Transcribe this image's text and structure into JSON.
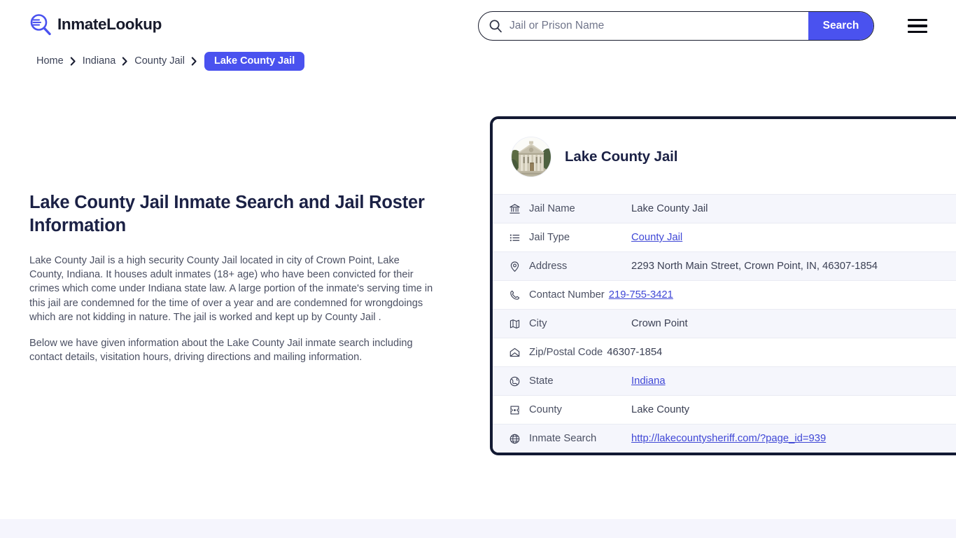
{
  "header": {
    "logo_text": "InmateLookup",
    "logo_icon": "magnifier-list-icon",
    "search": {
      "placeholder": "Jail or Prison Name",
      "value": "",
      "button_label": "Search",
      "icon": "search-icon"
    },
    "menu_icon": "hamburger-menu-icon"
  },
  "breadcrumb": {
    "items": [
      {
        "label": "Home",
        "current": false
      },
      {
        "label": "Indiana",
        "current": false
      },
      {
        "label": "County Jail",
        "current": false
      },
      {
        "label": "Lake County Jail",
        "current": true
      }
    ],
    "separator_icon": "chevron-right-icon"
  },
  "intro": {
    "title": "Lake County Jail Inmate Search and Jail Roster Information",
    "paragraph_1": "Lake County Jail is a high security County Jail located in city of Crown Point, Lake County, Indiana. It houses adult inmates (18+ age) who have been convicted for their crimes which come under Indiana state law. A large portion of the inmate's serving time in this jail are condemned for the time of over a year and are condemned for wrongdoings which are not kidding in nature. The jail is worked and kept up by County Jail .",
    "paragraph_2": "Below we have given information about the Lake County Jail inmate search including contact details, visitation hours, driving directions and mailing information."
  },
  "card": {
    "title": "Lake County Jail",
    "avatar_alt": "courthouse-building-photo",
    "rows": [
      {
        "icon": "bank-icon",
        "label": "Jail Name",
        "value": "Lake County Jail",
        "link": false
      },
      {
        "icon": "list-icon",
        "label": "Jail Type",
        "value": "County Jail",
        "link": true
      },
      {
        "icon": "map-pin-icon",
        "label": "Address",
        "value": "2293 North Main Street, Crown Point, IN, 46307-1854",
        "link": false
      },
      {
        "icon": "phone-icon",
        "label": "Contact Number",
        "value": "219-755-3421",
        "link": true
      },
      {
        "icon": "map-icon",
        "label": "City",
        "value": "Crown Point",
        "link": false
      },
      {
        "icon": "envelope-icon",
        "label": "Zip/Postal Code",
        "value": "46307-1854",
        "link": false
      },
      {
        "icon": "globe-icon",
        "label": "State",
        "value": "Indiana",
        "link": true
      },
      {
        "icon": "compass-icon",
        "label": "County",
        "value": "Lake County",
        "link": false
      },
      {
        "icon": "globe-grid-icon",
        "label": "Inmate Search",
        "value": "http://lakecountysheriff.com/?page_id=939",
        "link": true
      }
    ]
  },
  "colors": {
    "accent": "#4a52ef",
    "card_border": "#131a33",
    "row_alt": "#f5f6fc",
    "link": "#3f47d6",
    "title": "#1b2145",
    "footer_band": "#f5f5fd"
  }
}
